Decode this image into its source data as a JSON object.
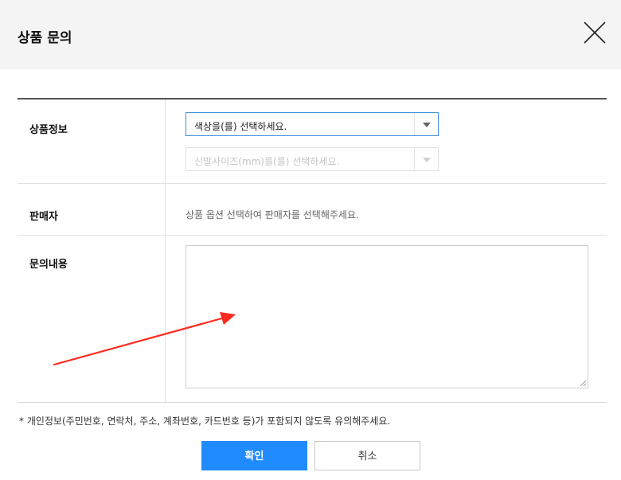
{
  "dialog": {
    "title": "상품 문의",
    "close_icon": "close-icon"
  },
  "form": {
    "product_info_label": "상품정보",
    "color_select": {
      "value": "색상을(를) 선택하세요.",
      "enabled": true
    },
    "size_select": {
      "value": "신발사이즈(mm)를(를) 선택하세요.",
      "enabled": false
    },
    "seller_label": "판매자",
    "seller_text": "상품 옵션 선택하여 판매자를 선택해주세요.",
    "inquiry_label": "문의내용",
    "inquiry_value": ""
  },
  "notice": "* 개인정보(주민번호, 연락처, 주소, 계좌번호, 카드번호 등)가 포함되지 않도록 유의해주세요.",
  "buttons": {
    "confirm": "확인",
    "cancel": "취소"
  },
  "colors": {
    "primary": "#1f8bff",
    "select_focus_border": "#3d8ee0",
    "header_bg": "#f4f4f4",
    "annotation_arrow": "#ff2a1f"
  }
}
